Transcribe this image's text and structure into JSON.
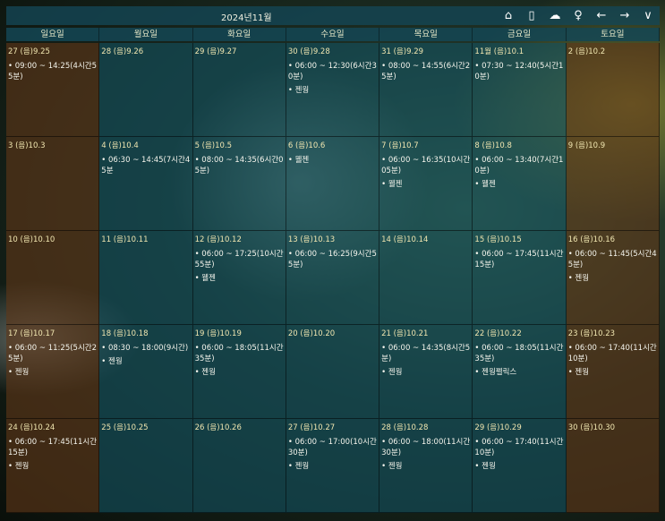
{
  "header": {
    "title": "2024년11월",
    "icons": [
      "home-icon",
      "phone-icon",
      "cloud-icon",
      "person-icon",
      "arrow-left-icon",
      "arrow-right-icon",
      "chevron-down-icon"
    ],
    "glyphs": [
      "⌂",
      "▯",
      "☁",
      "♀",
      "←",
      "→",
      "∨"
    ]
  },
  "weekdays": [
    "일요일",
    "월요일",
    "화요일",
    "수요일",
    "목요일",
    "금요일",
    "토요일"
  ],
  "days": [
    {
      "d": "27 (음)9.25",
      "e": [
        "09:00 ~ 14:25(4시간55분)"
      ]
    },
    {
      "d": "28 (음)9.26",
      "e": []
    },
    {
      "d": "29 (음)9.27",
      "e": []
    },
    {
      "d": "30 (음)9.28",
      "e": [
        "06:00 ~ 12:30(6시간30분)",
        "젠웡"
      ]
    },
    {
      "d": "31 (음)9.29",
      "e": [
        "08:00 ~ 14:55(6시간25분)"
      ]
    },
    {
      "d": "11월 (음)10.1",
      "e": [
        "07:30 ~ 12:40(5시간10분)"
      ]
    },
    {
      "d": "2 (음)10.2",
      "e": []
    },
    {
      "d": "3 (음)10.3",
      "e": []
    },
    {
      "d": "4 (음)10.4",
      "e": [
        "06:30 ~ 14:45(7시간45분"
      ]
    },
    {
      "d": "5 (음)10.5",
      "e": [
        "08:00 ~ 14:35(6시간05분)"
      ]
    },
    {
      "d": "6 (음)10.6",
      "e": [
        "웰젠"
      ]
    },
    {
      "d": "7 (음)10.7",
      "e": [
        "06:00 ~ 16:35(10시간05분)",
        "웰젠"
      ]
    },
    {
      "d": "8 (음)10.8",
      "e": [
        "06:00 ~ 13:40(7시간10분)",
        "웰젠"
      ]
    },
    {
      "d": "9 (음)10.9",
      "e": []
    },
    {
      "d": "10 (음)10.10",
      "e": []
    },
    {
      "d": "11 (음)10.11",
      "e": []
    },
    {
      "d": "12 (음)10.12",
      "e": [
        "06:00 ~ 17:25(10시간55분)",
        "웰젠"
      ]
    },
    {
      "d": "13 (음)10.13",
      "e": [
        "06:00 ~ 16:25(9시간55분)"
      ]
    },
    {
      "d": "14 (음)10.14",
      "e": []
    },
    {
      "d": "15 (음)10.15",
      "e": [
        "06:00 ~ 17:45(11시간15분)"
      ]
    },
    {
      "d": "16 (음)10.16",
      "e": [
        "06:00 ~ 11:45(5시간45분)",
        "젠웡"
      ]
    },
    {
      "d": "17 (음)10.17",
      "e": [
        "06:00 ~ 11:25(5시간25분)",
        "젠웡"
      ]
    },
    {
      "d": "18 (음)10.18",
      "e": [
        "08:30 ~ 18:00(9시간)",
        "젠웡"
      ]
    },
    {
      "d": "19 (음)10.19",
      "e": [
        "06:00 ~ 18:05(11시간35분)",
        "젠웡"
      ]
    },
    {
      "d": "20 (음)10.20",
      "e": []
    },
    {
      "d": "21 (음)10.21",
      "e": [
        "06:00 ~ 14:35(8시간5분)",
        "젠웡"
      ]
    },
    {
      "d": "22 (음)10.22",
      "e": [
        "06:00 ~ 18:05(11시간35분)",
        "젠웡펠릭스"
      ]
    },
    {
      "d": "23 (음)10.23",
      "e": [
        "06:00 ~ 17:40(11시간10분)",
        "젠웡"
      ]
    },
    {
      "d": "24 (음)10.24",
      "e": [
        "06:00 ~ 17:45(11시간15분)",
        "젠웡"
      ]
    },
    {
      "d": "25 (음)10.25",
      "e": []
    },
    {
      "d": "26 (음)10.26",
      "e": []
    },
    {
      "d": "27 (음)10.27",
      "e": [
        "06:00 ~ 17:00(10시간30분)",
        "젠웡"
      ]
    },
    {
      "d": "28 (음)10.28",
      "e": [
        "06:00 ~ 18:00(11시간30분)",
        "젠웡"
      ]
    },
    {
      "d": "29 (음)10.29",
      "e": [
        "06:00 ~ 17:40(11시간10분)",
        "젠웡"
      ]
    },
    {
      "d": "30 (음)10.30",
      "e": []
    }
  ]
}
